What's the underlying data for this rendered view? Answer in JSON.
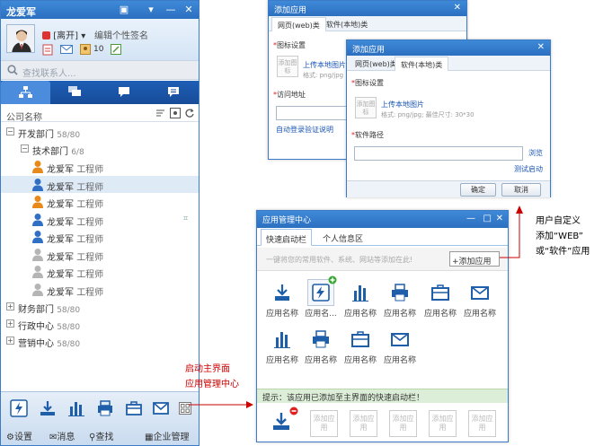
{
  "im": {
    "title": "龙爱军",
    "status": "[离开]",
    "signature_placeholder": "编辑个性签名",
    "mail_count": "10",
    "search_placeholder": "查找联系人...",
    "tree_header": "公司名称",
    "groups": [
      {
        "name": "开发部门",
        "count": "58/80",
        "toggle": "−"
      },
      {
        "name": "技术部门",
        "count": "6/8",
        "toggle": "−"
      },
      {
        "name": "财务部门",
        "count": "58/80",
        "toggle": "+"
      },
      {
        "name": "行政中心",
        "count": "58/80",
        "toggle": "+"
      },
      {
        "name": "营销中心",
        "count": "58/80",
        "toggle": "+"
      }
    ],
    "members": [
      {
        "name": "龙爱军",
        "title": "工程师",
        "color": "#e88a1a"
      },
      {
        "name": "龙爱军",
        "title": "工程师",
        "color": "#2f6fc4"
      },
      {
        "name": "龙爱军",
        "title": "工程师",
        "color": "#e88a1a"
      },
      {
        "name": "龙爱军",
        "title": "工程师",
        "color": "#2f6fc4"
      },
      {
        "name": "龙爱军",
        "title": "工程师",
        "color": "#2f6fc4"
      },
      {
        "name": "龙爱军",
        "title": "工程师",
        "color": "#b5b5b5"
      },
      {
        "name": "龙爱军",
        "title": "工程师",
        "color": "#b5b5b5"
      },
      {
        "name": "龙爱军",
        "title": "工程师",
        "color": "#b5b5b5"
      }
    ],
    "bottom_menu": {
      "settings": "设置",
      "messages": "消息",
      "find": "查找",
      "enterprise": "企业管理"
    }
  },
  "dialog_a": {
    "title": "添加应用",
    "tab_web": "网页(web)类",
    "tab_software": "软件(本地)类",
    "icon_label": "图标设置",
    "upload_placeholder": "添加图标",
    "upload_link": "上传本地图片",
    "upload_hint": "格式: png/jpg",
    "url_label": "访问地址",
    "auto_login": "自动登录验证说明"
  },
  "dialog_b": {
    "title": "添加应用",
    "tab_web": "网页(web)类",
    "tab_software": "软件(本地)类",
    "icon_label": "图标设置",
    "upload_placeholder": "添加图标",
    "upload_link": "上传本地图片",
    "upload_hint": "格式: png/jpg; 最佳尺寸: 30*30",
    "path_label": "软件路径",
    "browse": "浏览",
    "test_launch": "测试启动",
    "ok": "确定",
    "cancel": "取消"
  },
  "app_center": {
    "title": "应用管理中心",
    "tab_quick": "快速启动栏",
    "tab_info": "个人信息区",
    "search_placeholder": "一键将您的常用软件、系统、网站等添加在此!",
    "add_button": "添加应用",
    "apps": [
      {
        "label": "应用名称",
        "icon": "download-icon"
      },
      {
        "label": "应用名...",
        "icon": "lightning-icon"
      },
      {
        "label": "应用名称",
        "icon": "bar-chart-icon"
      },
      {
        "label": "应用名称",
        "icon": "print-icon"
      },
      {
        "label": "应用名称",
        "icon": "briefcase-icon"
      },
      {
        "label": "应用名称",
        "icon": "mail-icon"
      },
      {
        "label": "应用名称",
        "icon": "bar-chart-icon"
      },
      {
        "label": "应用名称",
        "icon": "print-icon"
      },
      {
        "label": "应用名称",
        "icon": "briefcase-icon"
      },
      {
        "label": "应用名称",
        "icon": "mail-icon"
      }
    ],
    "tip": "提示：该应用已添加至主界面的快速启动栏！",
    "slot_placeholder": "添加应用"
  },
  "annotations": {
    "left_1": "启动主界面",
    "left_2": "应用管理中心",
    "right_1": "用户自定义",
    "right_2": "添加“WEB”",
    "right_3": "或“软件”应用"
  },
  "colors": {
    "title_blue": "#2c6fc0",
    "tab_dark": "#174c99",
    "annotation_red": "#c00000",
    "link_blue": "#1a55b3"
  }
}
